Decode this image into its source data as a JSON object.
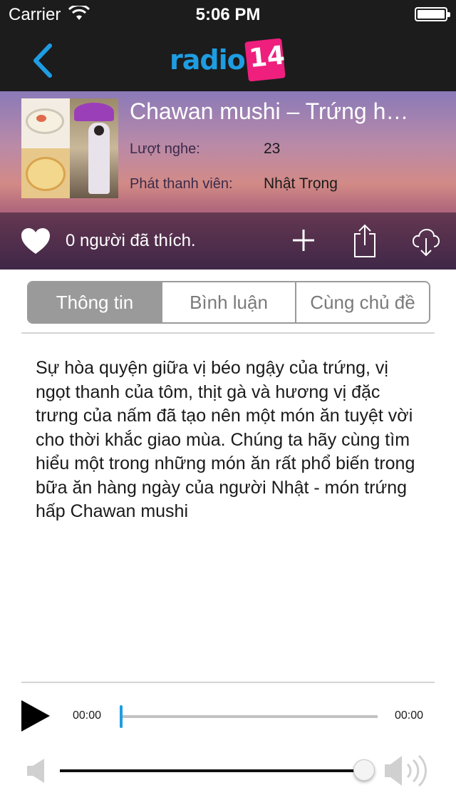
{
  "status_bar": {
    "carrier": "Carrier",
    "time": "5:06 PM",
    "battery_level": 1.0
  },
  "nav": {
    "back_icon": "chevron-left-icon",
    "logo_word": "radio",
    "logo_badge": "14",
    "accent": "#1e9de2",
    "badge_color": "#ee1f7d"
  },
  "episode": {
    "title": "Chawan mushi – Trứng h…",
    "plays_label": "Lượt nghe:",
    "plays_value": "23",
    "host_label": "Phát thanh viên:",
    "host_value": "Nhật Trọng",
    "likes_text": "0 người đã thích."
  },
  "actions": {
    "like_icon": "heart-icon",
    "add_icon": "plus-icon",
    "share_icon": "share-icon",
    "download_icon": "cloud-download-icon"
  },
  "tabs": [
    {
      "label": "Thông tin",
      "active": true
    },
    {
      "label": "Bình luận",
      "active": false
    },
    {
      "label": "Cùng chủ đề",
      "active": false
    }
  ],
  "description": "Sự hòa quyện giữa vị béo ngậy của trứng, vị ngọt thanh của tôm, thịt gà và hương vị đặc trưng của nấm đã tạo nên một món ăn tuyệt vời cho thời khắc giao mùa. Chúng ta hãy cùng tìm hiểu một trong những món ăn rất phổ biến trong bữa ăn hàng ngày của người Nhật - món trứng hấp Chawan mushi",
  "player": {
    "current_time": "00:00",
    "duration": "00:00",
    "progress": 0,
    "volume": 1.0
  }
}
